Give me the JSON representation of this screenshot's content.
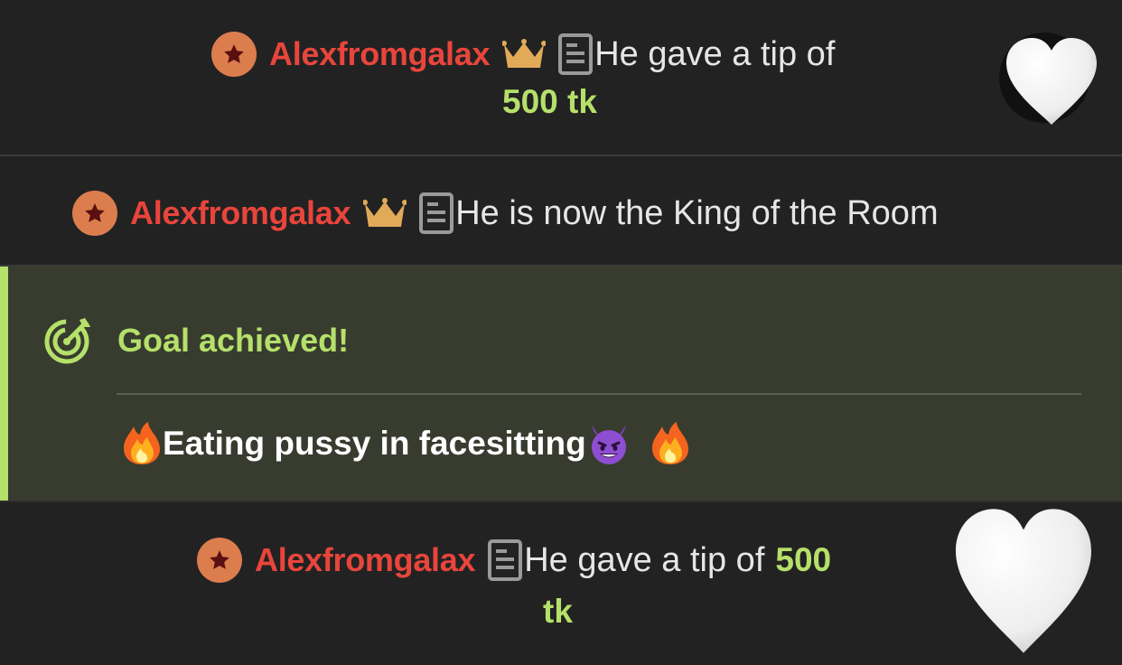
{
  "colors": {
    "background": "#222222",
    "goal_background": "#383c2f",
    "username": "#e8453c",
    "accent_green": "#b5e06a",
    "user_badge": "#dc7d4e",
    "crown": "#e0aa59",
    "text": "#e6e6e6"
  },
  "messages": [
    {
      "username": "Alexfromgalax",
      "badges": [
        "star-badge-icon",
        "crown-icon",
        "document-icon"
      ],
      "text": "He gave a tip of",
      "amount": "500 tk",
      "reaction": "white-heart-icon"
    },
    {
      "username": "Alexfromgalax",
      "badges": [
        "star-badge-icon",
        "crown-icon",
        "document-icon"
      ],
      "text": "He is now the King of the Room"
    },
    {
      "username": "Alexfromgalax",
      "badges": [
        "star-badge-icon",
        "document-icon"
      ],
      "text": "He gave a tip of",
      "amount_part1": "500",
      "amount_part2": "tk",
      "reaction": "white-heart-icon"
    }
  ],
  "goal": {
    "icon": "target-icon",
    "title": "Goal achieved!",
    "description": "Eating pussy in facesitting",
    "emojis": [
      "fire-emoji",
      "smiling-devil-emoji",
      "fire-emoji"
    ]
  }
}
